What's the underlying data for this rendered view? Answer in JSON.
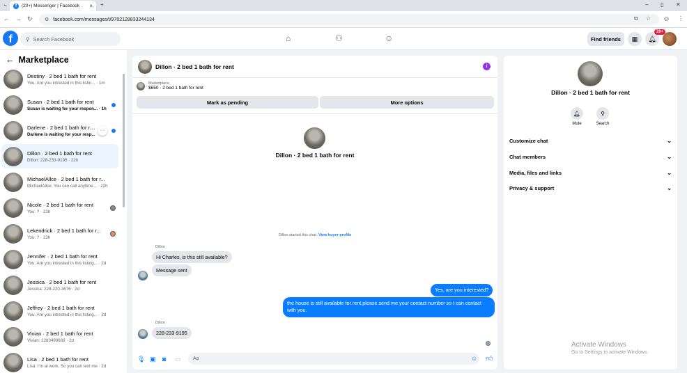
{
  "browser": {
    "tab_title": "(20+) Messenger | Facebook",
    "url": "facebook.com/messages/t/9702128833244134"
  },
  "header": {
    "search_placeholder": "Search Facebook",
    "find_friends": "Find friends",
    "notif_count": "20+"
  },
  "sidebar": {
    "title": "Marketplace",
    "conversations": [
      {
        "name": "Destiny · 2 bed 1 bath for rent",
        "preview": "You: Are you intrested in this listin... · 1m",
        "state": "read"
      },
      {
        "name": "Susan · 2 bed 1 bath for rent",
        "preview": "Susan is waiting for your respon... · 1h",
        "state": "unread"
      },
      {
        "name": "Darlene · 2 bed 1 bath for rent",
        "preview": "Darlene is waiting for your resp...",
        "state": "unread"
      },
      {
        "name": "Dillon · 2 bed 1 bath for rent",
        "preview": "Dillon: 228-233-9195 · 22h",
        "state": "active"
      },
      {
        "name": "MichaelAllce · 2 bed 1 bath for r...",
        "preview": "MichaelAllce: You can call anytime... · 22h",
        "state": "read"
      },
      {
        "name": "Nicole · 2 bed 1 bath for rent",
        "preview": "You: ? · 23h",
        "state": "read"
      },
      {
        "name": "Lekendrick · 2 bed 1 bath for r...",
        "preview": "You: ? · 23h",
        "state": "read"
      },
      {
        "name": "Jennifer · 2 bed 1 bath for rent",
        "preview": "You: Are you intrested in this listing... · 2d",
        "state": "read"
      },
      {
        "name": "Jessica · 2 bed 1 bath for rent",
        "preview": "Jessica: 228-220-3676 · 2d",
        "state": "read"
      },
      {
        "name": "Jeffrey · 2 bed 1 bath for rent",
        "preview": "You: Are you intrested in this listing... · 2d",
        "state": "read"
      },
      {
        "name": "Vivian · 2 bed 1 bath for rent",
        "preview": "Vivian: 2283499669 · 2d",
        "state": "read"
      },
      {
        "name": "Lisa · 2 bed 1 bath for rent",
        "preview": "Lisa: I'm at work. So you can text me · 2d",
        "state": "read"
      }
    ]
  },
  "chat": {
    "title": "Dillon · 2 bed 1 bath for rent",
    "listing_label": "Marketplace",
    "listing_price": "$650 · 2 bed 1 bath for rent",
    "mark_pending": "Mark as pending",
    "more_options": "More options",
    "center_name": "Dillon · 2 bed 1 bath for rent",
    "system_msg": "Dillon started this chat.",
    "system_link": "View buyer profile",
    "sender1": "Dillon",
    "msg_in_1": "Hi Charles, is this still available?",
    "msg_in_2": "Message sent",
    "msg_out_1": "Yes, are you interested?",
    "msg_out_2": "the house is still available for rent,please send me your contact number so I can contact with you.",
    "sender2": "Dillon",
    "msg_in_3": "228-233-9195",
    "composer_placeholder": "Aa"
  },
  "details": {
    "name": "Dillon · 2 bed 1 bath for rent",
    "mute": "Mute",
    "search": "Search",
    "sections": [
      "Customize chat",
      "Chat members",
      "Media, files and links",
      "Privacy & support"
    ]
  },
  "watermark": {
    "title": "Activate Windows",
    "subtitle": "Go to Settings to activate Windows."
  },
  "colors": {
    "brand": "#1877f2",
    "outgoing_bubble": "#0a7cff",
    "incoming_bubble": "#e4e6eb"
  }
}
